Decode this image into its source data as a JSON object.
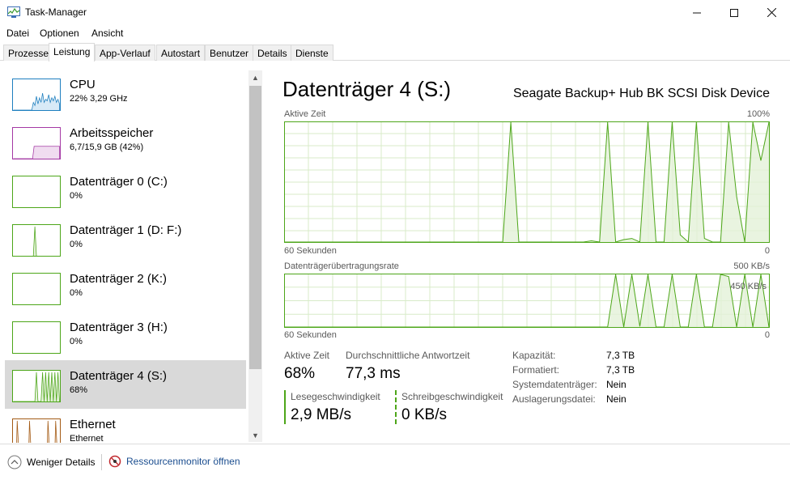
{
  "window": {
    "title": "Task-Manager"
  },
  "menu": [
    "Datei",
    "Optionen",
    "Ansicht"
  ],
  "tabs": [
    "Prozesse",
    "Leistung",
    "App-Verlauf",
    "Autostart",
    "Benutzer",
    "Details",
    "Dienste"
  ],
  "active_tab": "Leistung",
  "sidebar": {
    "items": [
      {
        "name": "CPU",
        "sub": "22%  3,29 GHz",
        "color": "#1e7fbf"
      },
      {
        "name": "Arbeitsspeicher",
        "sub": "6,7/15,9 GB (42%)",
        "color": "#a438a4"
      },
      {
        "name": "Datenträger 0 (C:)",
        "sub": "0%",
        "color": "#4da619"
      },
      {
        "name": "Datenträger 1 (D: F:)",
        "sub": "0%",
        "color": "#4da619"
      },
      {
        "name": "Datenträger 2 (K:)",
        "sub": "0%",
        "color": "#4da619"
      },
      {
        "name": "Datenträger 3 (H:)",
        "sub": "0%",
        "color": "#4da619"
      },
      {
        "name": "Datenträger 4 (S:)",
        "sub": "68%",
        "color": "#4da619",
        "selected": true
      },
      {
        "name": "Ethernet",
        "sub": "Ethernet",
        "color": "#a35a14"
      }
    ]
  },
  "main": {
    "title": "Datenträger 4 (S:)",
    "device": "Seagate Backup+ Hub BK SCSI Disk Device",
    "chart1": {
      "label": "Aktive Zeit",
      "max": "100%",
      "xlabel": "60 Sekunden",
      "min": "0"
    },
    "chart2": {
      "label": "Datenträgerübertragungsrate",
      "max": "500 KB/s",
      "mid": "450 KB/s",
      "xlabel": "60 Sekunden",
      "min": "0"
    },
    "stats": {
      "active_label": "Aktive Zeit",
      "active_value": "68%",
      "response_label": "Durchschnittliche Antwortzeit",
      "response_value": "77,3 ms",
      "read_label": "Lesegeschwindigkeit",
      "read_value": "2,9 MB/s",
      "write_label": "Schreibgeschwindigkeit",
      "write_value": "0 KB/s"
    },
    "specs": [
      {
        "key": "Kapazität:",
        "value": "7,3 TB"
      },
      {
        "key": "Formatiert:",
        "value": "7,3 TB"
      },
      {
        "key": "Systemdatenträger:",
        "value": "Nein"
      },
      {
        "key": "Auslagerungsdatei:",
        "value": "Nein"
      }
    ]
  },
  "footer": {
    "less_details": "Weniger Details",
    "resource_monitor": "Ressourcenmonitor öffnen"
  },
  "colors": {
    "disk": "#4da619",
    "disk_fill": "#e3f1d8",
    "grid": "#d8ebc9"
  },
  "chart_data": [
    {
      "type": "area",
      "title": "Aktive Zeit",
      "xlabel": "60 Sekunden",
      "ylim": [
        0,
        100
      ],
      "x": [
        0,
        1,
        2,
        3,
        4,
        5,
        6,
        7,
        8,
        9,
        10,
        11,
        12,
        13,
        14,
        15,
        16,
        17,
        18,
        19,
        20,
        21,
        22,
        23,
        24,
        25,
        26,
        27,
        28,
        29,
        30,
        31,
        32,
        33,
        34,
        35,
        36,
        37,
        38,
        39,
        40,
        41,
        42,
        43,
        44,
        45,
        46,
        47,
        48,
        49,
        50,
        51,
        52,
        53,
        54,
        55,
        56,
        57,
        58,
        59,
        60
      ],
      "values": [
        0,
        0,
        0,
        0,
        0,
        0,
        0,
        0,
        0,
        0,
        0,
        0,
        0,
        0,
        0,
        0,
        0,
        0,
        0,
        0,
        0,
        0,
        0,
        0,
        0,
        0,
        0,
        0,
        100,
        0,
        0,
        0,
        0,
        0,
        0,
        0,
        0,
        0,
        1,
        0,
        100,
        0,
        2,
        3,
        0,
        100,
        0,
        0,
        100,
        6,
        0,
        100,
        3,
        0,
        0,
        100,
        38,
        0,
        100,
        68,
        100
      ],
      "grid": true
    },
    {
      "type": "area",
      "title": "Datenträgerübertragungsrate",
      "xlabel": "60 Sekunden",
      "ylim": [
        0,
        500
      ],
      "series": [
        {
          "name": "Lesegeschwindigkeit",
          "values": [
            0,
            0,
            0,
            0,
            0,
            0,
            0,
            0,
            0,
            0,
            0,
            0,
            0,
            0,
            0,
            0,
            0,
            0,
            0,
            0,
            0,
            0,
            0,
            0,
            0,
            0,
            0,
            0,
            0,
            0,
            0,
            0,
            0,
            0,
            0,
            0,
            0,
            0,
            0,
            0,
            0,
            500,
            0,
            500,
            5,
            500,
            0,
            0,
            500,
            0,
            0,
            500,
            0,
            0,
            500,
            480,
            0,
            500,
            0,
            500,
            0
          ]
        },
        {
          "name": "Schreibgeschwindigkeit",
          "values": [
            0,
            0,
            0,
            0,
            0,
            0,
            0,
            0,
            0,
            0,
            0,
            0,
            0,
            0,
            0,
            0,
            0,
            0,
            0,
            0,
            0,
            0,
            0,
            0,
            0,
            0,
            0,
            0,
            0,
            0,
            0,
            0,
            0,
            0,
            0,
            0,
            0,
            0,
            0,
            0,
            0,
            0,
            0,
            0,
            0,
            0,
            0,
            0,
            0,
            0,
            0,
            0,
            0,
            0,
            0,
            0,
            0,
            0,
            0,
            0,
            0
          ]
        }
      ],
      "grid": true
    }
  ]
}
